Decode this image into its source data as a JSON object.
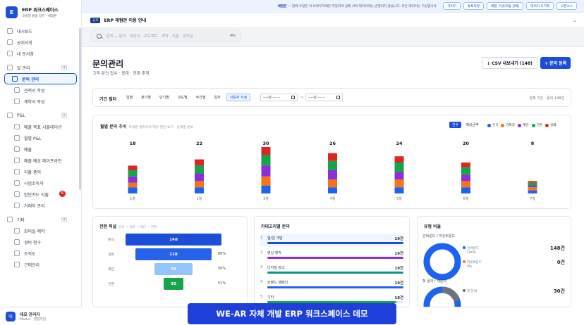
{
  "brand": {
    "logo": "E",
    "name": "ERP 워크스페이스",
    "sub": "모듈형 통합 업무 · 체험판"
  },
  "notice": {
    "lead": "체험판",
    "text": " — 입력·수정은 이 브라우저에만 저장되며 실제 서버 데이터에는 반영되지 않습니다. 모든 데이터는 가상입니다.",
    "buttons": [
      "가이드",
      "튜토리얼",
      "체험 구성(모듈 선택)",
      "데이터 초기화",
      "오픈소스"
    ]
  },
  "guide": {
    "tag": "공지",
    "title": "ERP 체험판 이용 안내",
    "chevron": "⌄"
  },
  "search": {
    "placeholder": "검색 — 문의 · 계산서 · 프로젝트 · 계약 · 지출 · 회의실",
    "shortcut": "⌘K"
  },
  "sidebar": {
    "items": [
      {
        "label": "대시보드",
        "icon": "grid-icon"
      },
      {
        "label": "공지사항",
        "icon": "megaphone-icon"
      },
      {
        "label": "내 문서함",
        "icon": "inbox-icon"
      }
    ],
    "sections": [
      {
        "label": "딜 관리",
        "toggle": "▾",
        "items": [
          {
            "label": "문의 관리",
            "active": true
          },
          {
            "label": "견적서 작성"
          },
          {
            "label": "계약서 작성"
          }
        ]
      },
      {
        "label": "P&L",
        "toggle": "▾",
        "items": [
          {
            "label": "매출 목표 시뮬레이션"
          },
          {
            "label": "월별 P&L"
          },
          {
            "label": "매출"
          },
          {
            "label": "매출 예상 파이프라인"
          },
          {
            "label": "지출 품의"
          },
          {
            "label": "사업소득자"
          },
          {
            "label": "법인카드 지출",
            "badge": "6"
          },
          {
            "label": "거래처 관리"
          }
        ]
      },
      {
        "label": "기타",
        "toggle": "▾",
        "items": [
          {
            "label": "회의실 예약"
          },
          {
            "label": "경비 청구"
          },
          {
            "label": "조직도"
          },
          {
            "label": "근태관리"
          }
        ]
      }
    ]
  },
  "user": {
    "avatar": "데",
    "name": "데모 관리자",
    "role": "Master · 영업지원"
  },
  "page": {
    "title": "문의관리",
    "subtitle": "고객 문의 접수 · 응대 · 전환 추적",
    "csv_button": "↓ CSV 내보내기 (148)",
    "new_button": "+ 문의 등록"
  },
  "filter": {
    "label": "기간 필터",
    "pills": [
      "일별",
      "분기별",
      "반기별",
      "년도별",
      "주간별",
      "일자",
      "사용자 지정"
    ],
    "active_pill": "사용자 지정",
    "date_from": "----년 --- --",
    "date_sep": "~",
    "date_to": "----년 --- --",
    "summary": "전체 기간 · 문의 148건"
  },
  "monthly": {
    "title": "월별 문의 추이",
    "hint": "막대를 클릭하여 해당 월만 보기 · 상태별 분포",
    "modes": [
      "건수",
      "예상금액"
    ],
    "active_mode": "건수",
    "legend": [
      {
        "name": "신규",
        "color": "#1d63ed"
      },
      {
        "name": "검토중",
        "color": "#f97316"
      },
      {
        "name": "제안",
        "color": "#8b2fd9"
      },
      {
        "name": "전환",
        "color": "#16a34a"
      },
      {
        "name": "실패",
        "color": "#dc2626"
      }
    ]
  },
  "chart_data": {
    "type": "bar",
    "stacked": true,
    "categories": [
      "1월",
      "2월",
      "3월",
      "4월",
      "5월",
      "6월",
      "7월"
    ],
    "totals": [
      18,
      22,
      30,
      26,
      24,
      20,
      8
    ],
    "series": [
      {
        "name": "신규",
        "values": [
          4,
          4,
          5,
          4,
          4,
          4,
          2
        ]
      },
      {
        "name": "검토중",
        "values": [
          3,
          4,
          6,
          5,
          5,
          4,
          2
        ]
      },
      {
        "name": "제안",
        "values": [
          4,
          5,
          7,
          6,
          5,
          4,
          1
        ]
      },
      {
        "name": "전환",
        "values": [
          4,
          5,
          7,
          6,
          6,
          5,
          2
        ]
      },
      {
        "name": "실패",
        "values": [
          3,
          4,
          5,
          5,
          4,
          3,
          1
        ]
      }
    ]
  },
  "funnel": {
    "title": "전환 퍼널",
    "hint": "문의 → 검토 → 제안 → 전환",
    "rows": [
      {
        "label": "문의",
        "value": "148",
        "pct": "",
        "frac": 1.0,
        "color": "#1d4ed8"
      },
      {
        "label": "검토",
        "value": "118",
        "pct": "80%",
        "frac": 0.8,
        "color": "#2563eb"
      },
      {
        "label": "제안",
        "value": "59",
        "pct": "50%",
        "frac": 0.4,
        "color": "#93c5fd"
      },
      {
        "label": "전환",
        "value": "30",
        "pct": "51%",
        "frac": 0.2,
        "color": "#16a34a"
      }
    ]
  },
  "category": {
    "title": "카테고리별 문의",
    "rows": [
      {
        "num": "1",
        "name": "웹/앱 개발",
        "count": "19건",
        "frac": 1.0,
        "color": "#1d4ed8"
      },
      {
        "num": "2",
        "name": "영상 제작",
        "count": "19건",
        "frac": 1.0,
        "color": "#8b2fd9"
      },
      {
        "num": "3",
        "name": "디지털 광고",
        "count": "19건",
        "frac": 1.0,
        "color": "#0d9488"
      },
      {
        "num": "4",
        "name": "브랜드 캠페인",
        "count": "19건",
        "frac": 1.0,
        "color": "#2563eb"
      },
      {
        "num": "5",
        "name": "기타",
        "count": "18건",
        "frac": 0.95,
        "color": "#16a34a"
      }
    ]
  },
  "types": {
    "title": "유형 비율",
    "sections": [
      {
        "label": "인바운드 / 아웃바운드",
        "legend": [
          {
            "name": "인바운드",
            "pct": "100%",
            "color": "#1d63ed"
          },
          {
            "name": "아웃바운드",
            "pct": "0%",
            "color": "#f97316"
          }
        ],
        "values": [
          "148건",
          "0건"
        ]
      },
      {
        "label": "첫 문의 / 재문의",
        "legend": [
          {
            "name": "첫 문의",
            "pct": "",
            "color": "#6b7280"
          }
        ],
        "values": [
          "30건"
        ]
      }
    ]
  },
  "banner": "WE-AR 자체 개발 ERP 워크스페이스 데모"
}
